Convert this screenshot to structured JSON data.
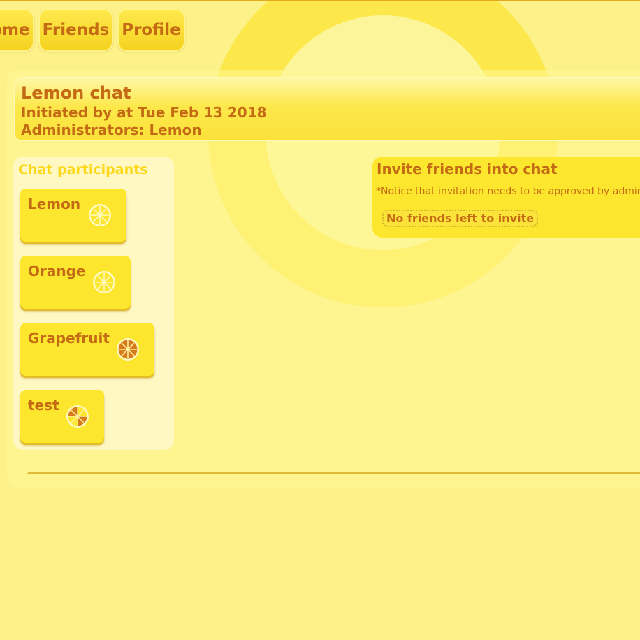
{
  "nav": {
    "items": [
      {
        "label": "Home"
      },
      {
        "label": "Friends"
      },
      {
        "label": "Profile"
      }
    ]
  },
  "chat": {
    "title": "Lemon chat",
    "initiated": "Initiated by at Tue Feb 13 2018",
    "administrators": "Administrators: Lemon"
  },
  "participants": {
    "heading": "Chat participants",
    "items": [
      {
        "name": "Lemon",
        "icon": "lemon-slice-icon"
      },
      {
        "name": "Orange",
        "icon": "lemon-slice-icon"
      },
      {
        "name": "Grapefruit",
        "icon": "grapefruit-slice-icon"
      },
      {
        "name": "test",
        "icon": "mixed-citrus-slice-icon"
      }
    ]
  },
  "invite": {
    "heading": "Invite friends into chat",
    "notice": "*Notice that invitation needs to be approved by admin",
    "no_friends": "No friends left to invite"
  },
  "colors": {
    "background": "#fdf28a",
    "accent": "#fde72e",
    "text": "#c46a14",
    "participants_heading": "#fbd81a"
  }
}
